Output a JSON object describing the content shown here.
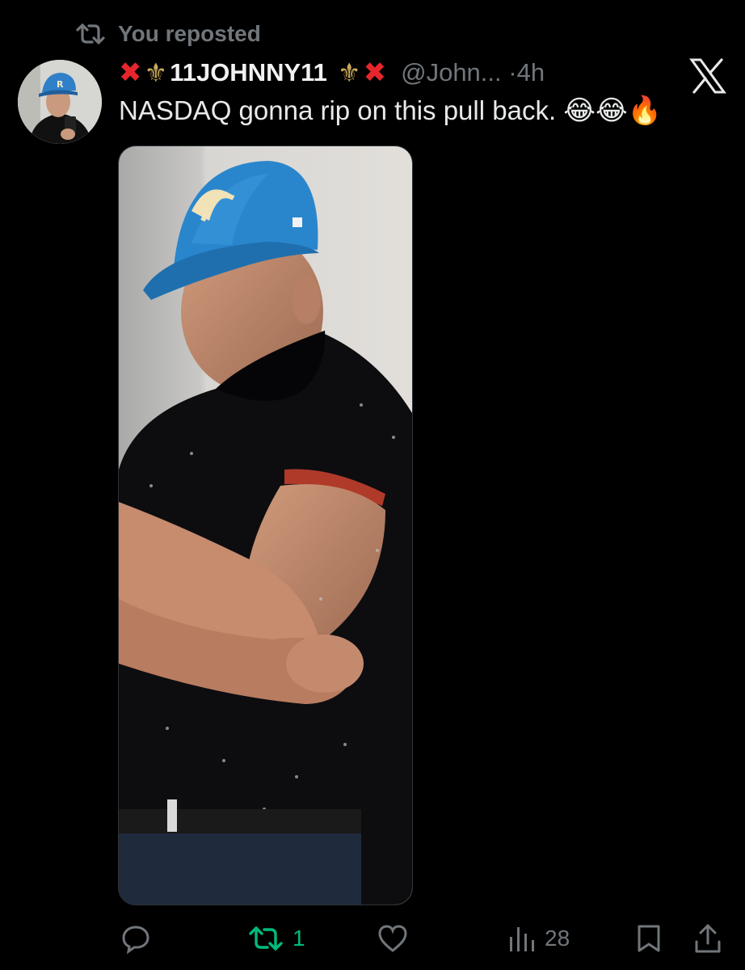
{
  "repost_banner": {
    "icon": "repost-icon",
    "text": "You reposted"
  },
  "tweet": {
    "author": {
      "name": "11JOHNNY11",
      "name_decor_left": "❌⚜️",
      "name_decor_right": "⚜️❌",
      "handle": "@John...",
      "time_separator": "·",
      "time": "4h",
      "avatar_icon": "user-avatar"
    },
    "text": "NASDAQ gonna rip on this pull back.",
    "emojis": "😂😂🔥",
    "media": {
      "type": "photo",
      "accent": "#1f6fae"
    },
    "platform_icon": "x-logo-icon"
  },
  "actions": {
    "reply": {
      "icon": "reply-icon",
      "count": ""
    },
    "repost": {
      "icon": "repost-icon",
      "count": "1",
      "color": "#00ba7c"
    },
    "like": {
      "icon": "heart-icon",
      "count": ""
    },
    "views": {
      "icon": "views-icon",
      "count": "28"
    },
    "bookmark": {
      "icon": "bookmark-icon"
    },
    "share": {
      "icon": "share-icon"
    }
  },
  "colors": {
    "background": "#000000",
    "text_primary": "#e7e9ea",
    "text_secondary": "#71767b",
    "retweet_green": "#00ba7c",
    "x_red": "#e5262c",
    "fleur_gold": "#c8a95a"
  }
}
